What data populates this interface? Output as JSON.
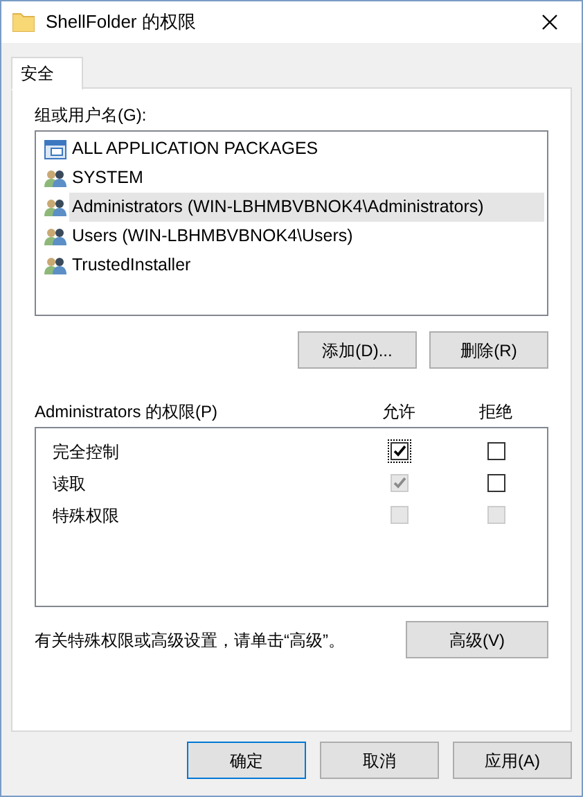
{
  "window": {
    "title": "ShellFolder 的权限"
  },
  "tabs": [
    {
      "label": "安全",
      "selected": true
    }
  ],
  "groups": {
    "label": "组或用户名(G):",
    "items": [
      {
        "name": "ALL APPLICATION PACKAGES",
        "kind": "package",
        "selected": false
      },
      {
        "name": "SYSTEM",
        "kind": "group",
        "selected": false
      },
      {
        "name": "Administrators (WIN-LBHMBVBNOK4\\Administrators)",
        "kind": "group",
        "selected": true
      },
      {
        "name": "Users (WIN-LBHMBVBNOK4\\Users)",
        "kind": "group",
        "selected": false
      },
      {
        "name": "TrustedInstaller",
        "kind": "group",
        "selected": false
      }
    ]
  },
  "group_buttons": [
    "添加(D)...",
    "删除(R)"
  ],
  "permissions": {
    "label": "Administrators 的权限(P)",
    "allow_header": "允许",
    "deny_header": "拒绝",
    "rows": [
      {
        "name": "完全控制",
        "allow": {
          "checked": true,
          "disabled": false,
          "focused": true
        },
        "deny": {
          "checked": false,
          "disabled": false
        }
      },
      {
        "name": "读取",
        "allow": {
          "checked": true,
          "disabled": true
        },
        "deny": {
          "checked": false,
          "disabled": false
        }
      },
      {
        "name": "特殊权限",
        "allow": {
          "checked": false,
          "disabled": true
        },
        "deny": {
          "checked": false,
          "disabled": true
        }
      }
    ]
  },
  "advanced_note": "有关特殊权限或高级设置，请单击“高级”。",
  "advanced_button": "高级(V)",
  "buttons": [
    {
      "label": "确定",
      "default": true
    },
    {
      "label": "取消",
      "default": false
    },
    {
      "label": "应用(A)",
      "default": false
    }
  ]
}
